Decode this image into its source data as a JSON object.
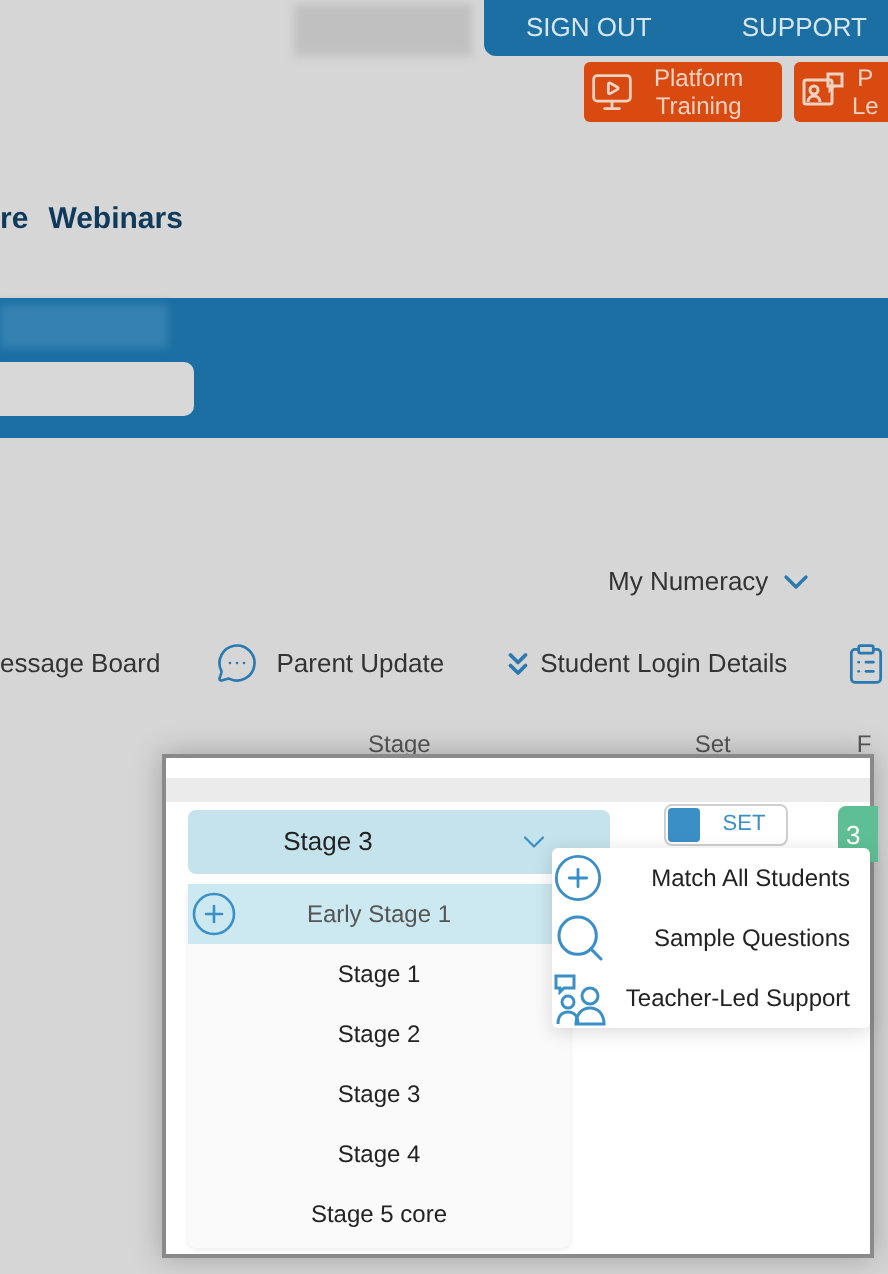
{
  "top_bar": {
    "links": [
      "SIGN OUT",
      "SUPPORT"
    ]
  },
  "quick_links": [
    {
      "lines": [
        "Platform",
        "Training"
      ],
      "kind": "video"
    },
    {
      "lines": [
        "P",
        "Le"
      ],
      "kind": "presenter"
    }
  ],
  "nav": {
    "items": [
      "re",
      "Webinars"
    ]
  },
  "program_menu": {
    "label": "My Numeracy"
  },
  "toolbar": {
    "items": [
      {
        "label": "essage Board",
        "kind": "text"
      },
      {
        "label": "Parent Update",
        "kind": "chat"
      },
      {
        "label": "Student Login Details",
        "kind": "chevrons"
      },
      {
        "kind": "list"
      }
    ]
  },
  "table": {
    "columns": [
      "Stage",
      "Set",
      "F"
    ]
  },
  "dialog": {
    "stage_select": {
      "value": "Stage 3",
      "expanded": true,
      "options": [
        {
          "label": "Early Stage 1",
          "highlighted": true
        },
        {
          "label": "Stage 1",
          "highlighted": false
        },
        {
          "label": "Stage 2",
          "highlighted": false
        },
        {
          "label": "Stage 3",
          "highlighted": false
        },
        {
          "label": "Stage 4",
          "highlighted": false
        },
        {
          "label": "Stage 5 core",
          "highlighted": false
        }
      ]
    },
    "set_toggle": {
      "label": "SET",
      "on": false
    },
    "badge": "3",
    "actions": [
      {
        "label": "Match All Students",
        "kind": "match"
      },
      {
        "label": "Sample Questions",
        "kind": "search"
      },
      {
        "label": "Teacher-Led Support",
        "kind": "support"
      }
    ]
  }
}
